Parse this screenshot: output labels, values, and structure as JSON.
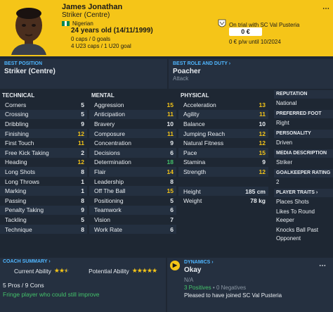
{
  "header": {
    "name": "James Jonathan",
    "role": "Striker (Centre)",
    "nationality": "Nigerian",
    "age": "24 years old (14/11/1999)",
    "caps_senior": "0 caps / 0 goals",
    "caps_u23": "4 U23 caps / 1 U20 goal",
    "trial": "On trial with SC Val Pusteria",
    "value": "0 €",
    "wage": "0 € p/w until 10/2024",
    "more": "⋯"
  },
  "best_position": {
    "title": "BEST POSITION",
    "value": "Striker (Centre)"
  },
  "best_role": {
    "title": "BEST ROLE AND DUTY",
    "value": "Poacher",
    "duty": "Attack"
  },
  "technical": {
    "title": "TECHNICAL",
    "rows": [
      {
        "label": "Corners",
        "value": "5"
      },
      {
        "label": "Crossing",
        "value": "5"
      },
      {
        "label": "Dribbling",
        "value": "9"
      },
      {
        "label": "Finishing",
        "value": "12"
      },
      {
        "label": "First Touch",
        "value": "11"
      },
      {
        "label": "Free Kick Taking",
        "value": "2"
      },
      {
        "label": "Heading",
        "value": "12"
      },
      {
        "label": "Long Shots",
        "value": "8"
      },
      {
        "label": "Long Throws",
        "value": "1"
      },
      {
        "label": "Marking",
        "value": "1"
      },
      {
        "label": "Passing",
        "value": "8"
      },
      {
        "label": "Penalty Taking",
        "value": "9"
      },
      {
        "label": "Tackling",
        "value": "5"
      },
      {
        "label": "Technique",
        "value": "8"
      }
    ]
  },
  "mental": {
    "title": "MENTAL",
    "rows": [
      {
        "label": "Aggression",
        "value": "15"
      },
      {
        "label": "Anticipation",
        "value": "11"
      },
      {
        "label": "Bravery",
        "value": "10"
      },
      {
        "label": "Composure",
        "value": "11"
      },
      {
        "label": "Concentration",
        "value": "9"
      },
      {
        "label": "Decisions",
        "value": "6"
      },
      {
        "label": "Determination",
        "value": "18"
      },
      {
        "label": "Flair",
        "value": "14"
      },
      {
        "label": "Leadership",
        "value": "8"
      },
      {
        "label": "Off The Ball",
        "value": "15"
      },
      {
        "label": "Positioning",
        "value": "5"
      },
      {
        "label": "Teamwork",
        "value": "6"
      },
      {
        "label": "Vision",
        "value": "7"
      },
      {
        "label": "Work Rate",
        "value": "6"
      }
    ]
  },
  "physical": {
    "title": "PHYSICAL",
    "rows": [
      {
        "label": "Acceleration",
        "value": "13"
      },
      {
        "label": "Agility",
        "value": "11"
      },
      {
        "label": "Balance",
        "value": "10"
      },
      {
        "label": "Jumping Reach",
        "value": "12"
      },
      {
        "label": "Natural Fitness",
        "value": "12"
      },
      {
        "label": "Pace",
        "value": "15"
      },
      {
        "label": "Stamina",
        "value": "9"
      },
      {
        "label": "Strength",
        "value": "12"
      }
    ],
    "height_label": "Height",
    "height": "185 cm",
    "weight_label": "Weight",
    "weight": "78 kg"
  },
  "side": {
    "reputation_title": "REPUTATION",
    "reputation": "National",
    "foot_title": "PREFERRED FOOT",
    "foot": "Right",
    "personality_title": "PERSONALITY",
    "personality": "Driven",
    "media_title": "MEDIA DESCRIPTION",
    "media": "Striker",
    "gk_title": "GOALKEEPER RATING",
    "gk": "2",
    "traits_title": "PLAYER TRAITS",
    "traits": [
      "Places Shots",
      "Likes To Round Keeper",
      "Knocks Ball Past Opponent"
    ]
  },
  "coach": {
    "title": "COACH SUMMARY",
    "current_label": "Current Ability",
    "potential_label": "Potential Ability",
    "current_stars": 2.5,
    "potential_stars": 5,
    "pros": "5 Pros / 9 Cons",
    "summary": "Fringe player who could still improve"
  },
  "dynamics": {
    "title": "DYNAMICS",
    "status": "Okay",
    "na": "N/A",
    "positives": "3 Positives",
    "negatives": "0 Negatives",
    "sep": " • ",
    "note": "Pleased to have joined SC Val Pusteria",
    "more": "⋯"
  },
  "colors": {
    "accent": "#f5c518",
    "link": "#4fb6ff",
    "positive": "#44c26a"
  }
}
